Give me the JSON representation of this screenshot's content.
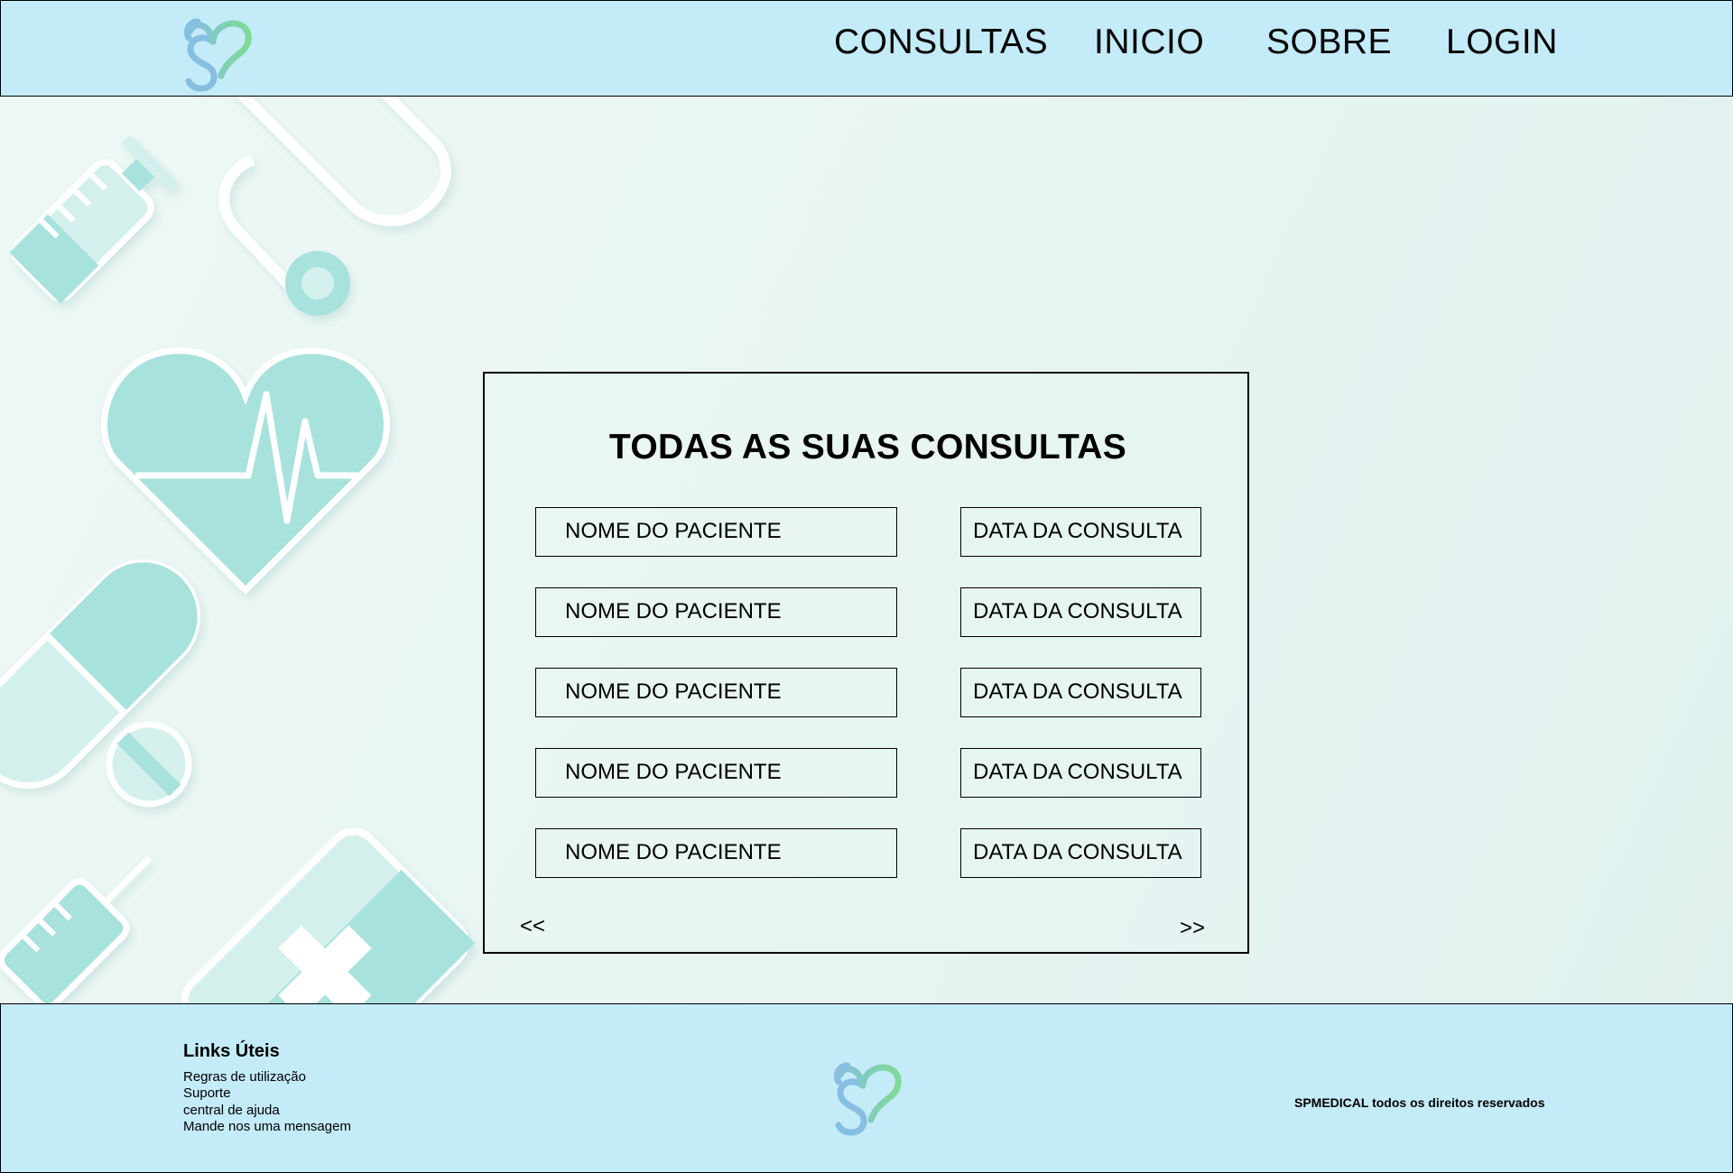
{
  "header": {
    "nav": [
      "CONSULTAS",
      "INICIO",
      "SOBRE",
      "LOGIN"
    ]
  },
  "card": {
    "title": "TODAS AS SUAS CONSULTAS",
    "rows": [
      {
        "name": "NOME DO PACIENTE",
        "date": "DATA DA CONSULTA"
      },
      {
        "name": "NOME DO PACIENTE",
        "date": "DATA DA CONSULTA"
      },
      {
        "name": "NOME DO PACIENTE",
        "date": "DATA DA CONSULTA"
      },
      {
        "name": "NOME DO PACIENTE",
        "date": "DATA DA CONSULTA"
      },
      {
        "name": "NOME DO PACIENTE",
        "date": "DATA DA CONSULTA"
      }
    ],
    "prev": "<<",
    "next": ">>"
  },
  "footer": {
    "links_title": "Links Úteis",
    "links": [
      "Regras de utilização",
      "Suporte",
      "central de ajuda",
      "Mande nos uma mensagem"
    ],
    "copyright": "SPMEDICAL todos os direitos reservados"
  },
  "icons": {
    "logo": "heart-s-logo-icon",
    "decor": [
      "syringe-icon",
      "stethoscope-icon",
      "heart-pulse-icon",
      "pill-capsule-icon",
      "tablet-icon",
      "first-aid-bag-icon"
    ]
  },
  "colors": {
    "bar_background": "#c4ebf8",
    "page_background": "#e9f5f3",
    "decor_teal": "#a8e2dd",
    "decor_light": "#d4f0ec",
    "logo_blue": "#86bfe0",
    "logo_green": "#7edb95"
  }
}
